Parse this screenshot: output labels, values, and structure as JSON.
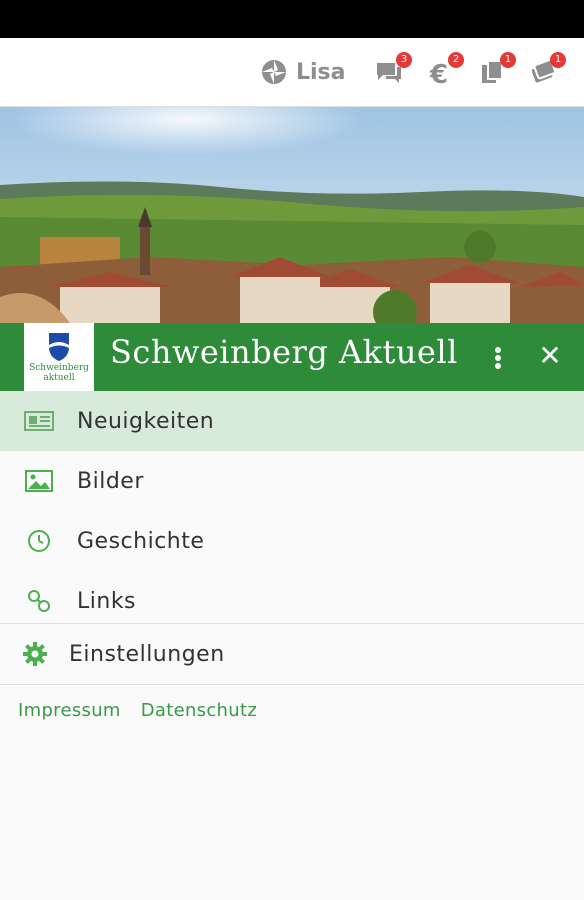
{
  "topbar": {
    "user_label": "Lisa",
    "badges": {
      "messages": "3",
      "euro": "2",
      "documents": "1",
      "tickets": "1"
    }
  },
  "header": {
    "logo_line1": "Schweinberg",
    "logo_line2": "aktuell",
    "title": "Schweinberg Aktuell",
    "close_glyph": "✕"
  },
  "menu": {
    "items": [
      {
        "label": "Neuigkeiten",
        "icon": "newspaper-icon",
        "active": true
      },
      {
        "label": "Bilder",
        "icon": "image-icon",
        "active": false
      },
      {
        "label": "Geschichte",
        "icon": "clock-icon",
        "active": false
      },
      {
        "label": "Links",
        "icon": "link-icon",
        "active": false
      }
    ],
    "settings_label": "Einstellungen"
  },
  "footer": {
    "impressum": "Impressum",
    "datenschutz": "Datenschutz"
  },
  "colors": {
    "accent": "#2e8b3a",
    "active_bg": "#d8ead9",
    "badge": "#e53935",
    "icon_green": "#4caf50"
  }
}
